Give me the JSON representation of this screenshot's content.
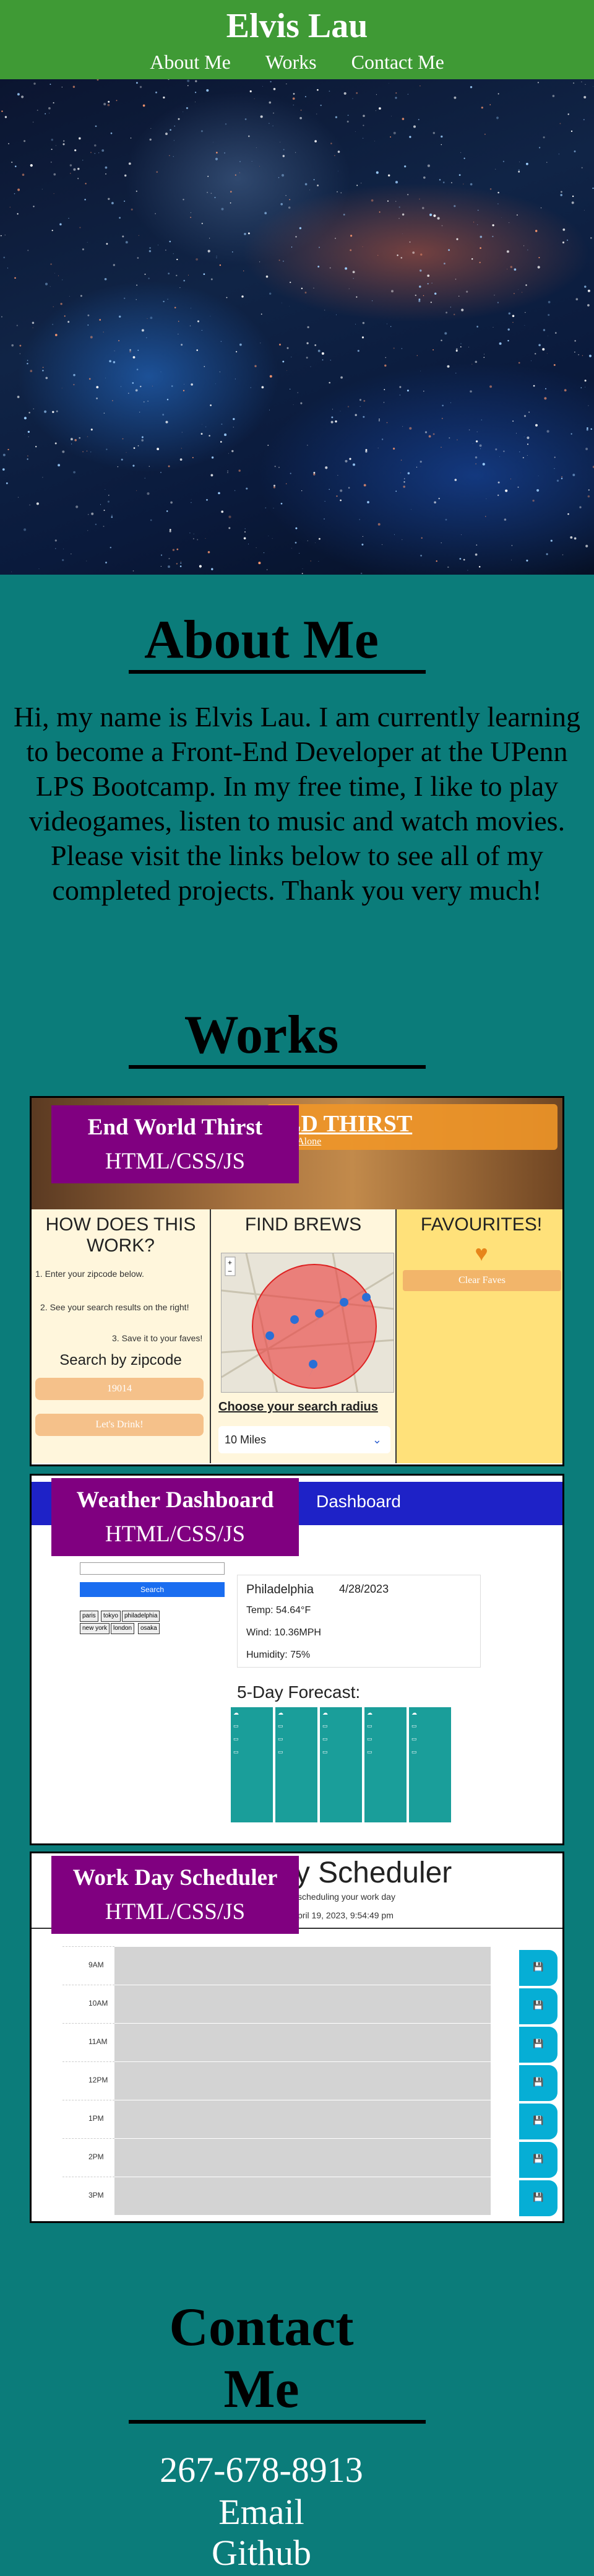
{
  "header": {
    "title": "Elvis Lau",
    "nav": [
      "About Me",
      "Works",
      "Contact Me"
    ]
  },
  "about": {
    "heading": "About Me",
    "text": "Hi, my name is Elvis Lau. I am currently learning to become a Front-End Developer at the UPenn LPS Bootcamp. In my free time, I like to play videogames, listen to music and watch movies. Please visit the links below to see all of my completed projects. Thank you very much!"
  },
  "works": {
    "heading": "Works",
    "projects": [
      {
        "name": "End World Thirst",
        "tech": "HTML/CSS/JS",
        "preview": {
          "banner_title": "LD THIRST",
          "banner_sub": "nk Alone",
          "col1_heading": "HOW DOES THIS WORK?",
          "steps": [
            "1. Enter your zipcode below.",
            "2. See your search results on the right!",
            "3. Save it to your faves!"
          ],
          "search_heading": "Search by zipcode",
          "zip_value": "19014",
          "drink_button": "Let's Drink!",
          "col2_heading": "FIND BREWS",
          "radius_label": "Choose your search radius",
          "radius_value": "10 Miles",
          "col3_heading": "FAVOURITES!",
          "clear_button": "Clear Faves"
        }
      },
      {
        "name": "Weather Dashboard",
        "tech": "HTML/CSS/JS",
        "preview": {
          "band_title": "Dashboard",
          "search_button": "Search",
          "history": [
            "paris",
            "tokyo",
            "philadelphia",
            "new york",
            "london",
            "osaka"
          ],
          "city": "Philadelphia",
          "date": "4/28/2023",
          "temp": "Temp: 54.64°F",
          "wind": "Wind: 10.36MPH",
          "humidity": "Humidity: 75%",
          "forecast_heading": "5-Day Forecast:"
        }
      },
      {
        "name": "Work Day Scheduler",
        "tech": "HTML/CSS/JS",
        "preview": {
          "title": "Work Day Scheduler",
          "subtitle": "scheduling your work day",
          "date": "pril 19, 2023, 9:54:49 pm",
          "hours": [
            "9AM",
            "10AM",
            "11AM",
            "12PM",
            "1PM",
            "2PM",
            "3PM"
          ]
        }
      }
    ]
  },
  "contact": {
    "heading_line1": "Contact",
    "heading_line2": "Me",
    "phone": "267-678-8913",
    "email": "Email",
    "github": "Github"
  },
  "colors": {
    "header_bg": "#3f9a35",
    "page_bg": "#0b7c7a",
    "label_bg": "#800080"
  }
}
